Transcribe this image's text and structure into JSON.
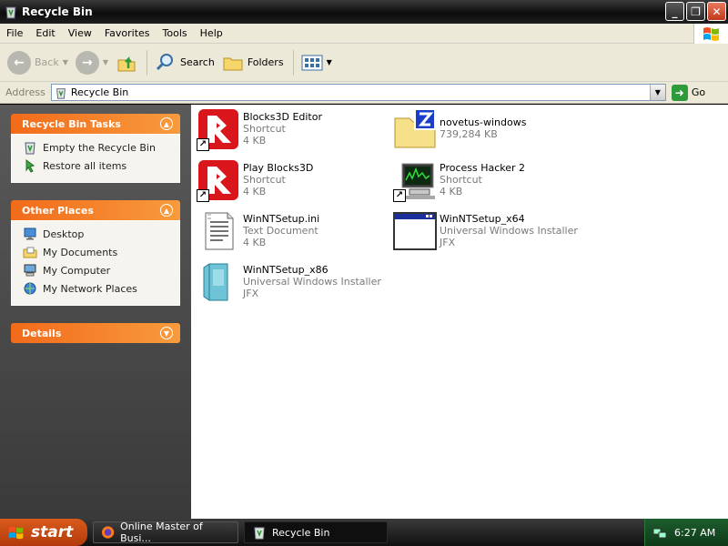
{
  "window": {
    "title": "Recycle Bin",
    "minimize_glyph": "_",
    "restore_glyph": "❐",
    "close_glyph": "✕"
  },
  "menu": [
    "File",
    "Edit",
    "View",
    "Favorites",
    "Tools",
    "Help"
  ],
  "toolbar": {
    "back_label": "Back",
    "search_label": "Search",
    "folders_label": "Folders"
  },
  "address": {
    "label": "Address",
    "value": "Recycle Bin",
    "go_label": "Go"
  },
  "tasks": {
    "recycle": {
      "title": "Recycle Bin Tasks",
      "items": [
        "Empty the Recycle Bin",
        "Restore all items"
      ]
    },
    "other": {
      "title": "Other Places",
      "items": [
        "Desktop",
        "My Documents",
        "My Computer",
        "My Network Places"
      ]
    },
    "details": {
      "title": "Details"
    }
  },
  "files": [
    {
      "name": "Blocks3D Editor",
      "type": "Shortcut",
      "size": "4 KB",
      "icon": "blocks3d-icon"
    },
    {
      "name": "novetus-windows",
      "type": "739,284 KB",
      "size": "",
      "icon": "zip-folder-icon"
    },
    {
      "name": "Play Blocks3D",
      "type": "Shortcut",
      "size": "4 KB",
      "icon": "blocks3d-icon"
    },
    {
      "name": "Process Hacker 2",
      "type": "Shortcut",
      "size": "4 KB",
      "icon": "process-hacker-icon"
    },
    {
      "name": "WinNTSetup.ini",
      "type": "Text Document",
      "size": "4 KB",
      "icon": "text-document-icon"
    },
    {
      "name": "WinNTSetup_x64",
      "type": "Universal Windows Installer",
      "size": "JFX",
      "icon": "installer-window-icon"
    },
    {
      "name": "WinNTSetup_x86",
      "type": "Universal Windows Installer",
      "size": "JFX",
      "icon": "installer-package-icon"
    }
  ],
  "taskbar": {
    "start_label": "start",
    "tasks": [
      "Online Master of Busi...",
      "Recycle Bin"
    ],
    "clock": "6:27 AM"
  },
  "colors": {
    "task_header": "#f26b1b",
    "left_pane": "#4a4a4a",
    "titlebar": "#1a1a1a"
  }
}
